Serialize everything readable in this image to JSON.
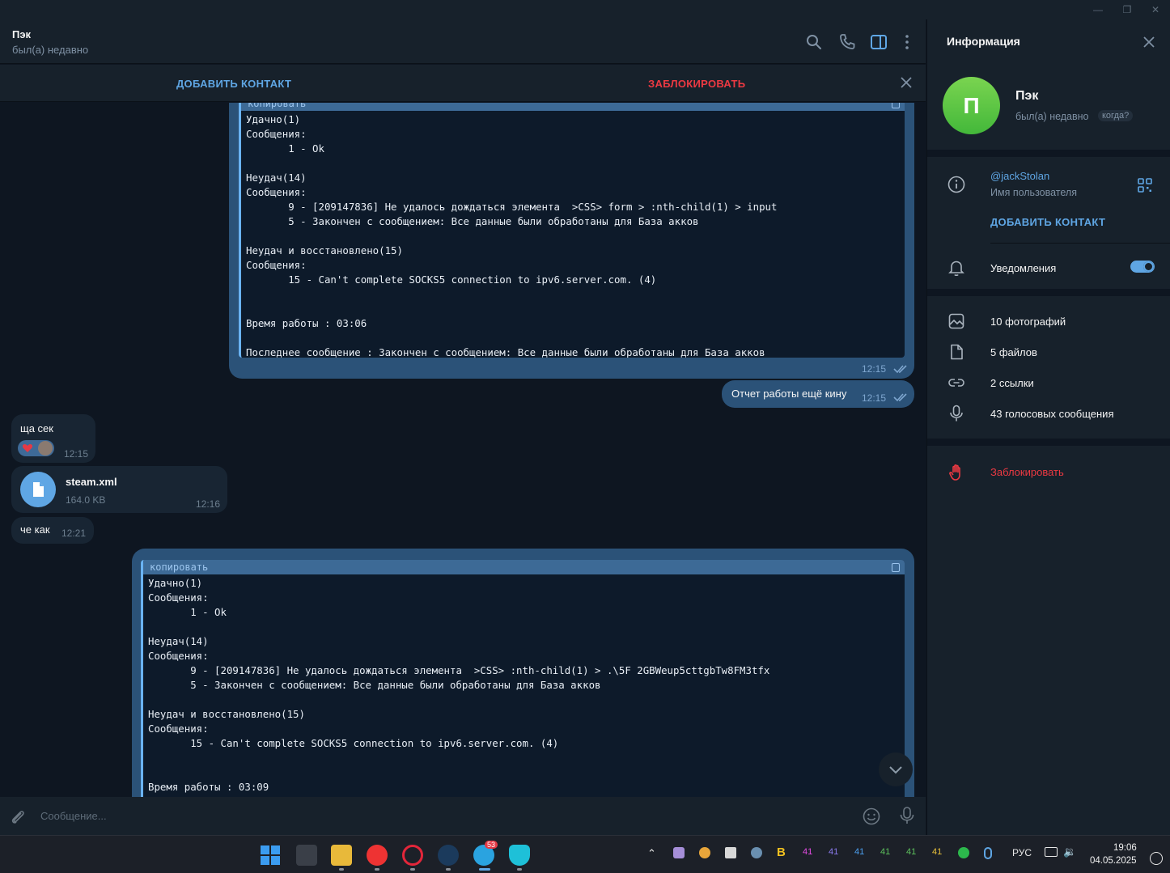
{
  "window": {
    "minimize": "—",
    "restore": "❐",
    "close": "✕"
  },
  "chat": {
    "name": "Пэк",
    "status": "был(а) недавно"
  },
  "action_bar": {
    "add_contact": "ДОБАВИТЬ КОНТАКТ",
    "block": "ЗАБЛОКИРОВАТЬ"
  },
  "messages": {
    "code1": {
      "header": "копировать",
      "text": "Удачно(1)\nСообщения:\n       1 - Ok\n\nНеудач(14)\nСообщения:\n       9 - [209147836] Не удалось дождаться элемента  >CSS> form > :nth-child(1) > input\n       5 - Закончен с сообщением: Все данные были обработаны для База акков\n\nНеудач и восстановлено(15)\nСообщения:\n       15 - Can't complete SOCKS5 connection to ipv6.server.com. (4)\n\n\nВремя работы : 03:06\n\nПоследнее сообщение : Закончен с сообщением: Все данные были обработаны для База акков",
      "time": "12:15"
    },
    "out2": {
      "text": "Отчет работы ещё кину",
      "time": "12:15"
    },
    "in1": {
      "text": "ща сек",
      "time": "12:15"
    },
    "file": {
      "name": "steam.xml",
      "size": "164.0 KB",
      "time": "12:16"
    },
    "in2": {
      "text": "че как",
      "time": "12:21"
    },
    "code2": {
      "header": "копировать",
      "text": "Удачно(1)\nСообщения:\n       1 - Ok\n\nНеудач(14)\nСообщения:\n       9 - [209147836] Не удалось дождаться элемента  >CSS> :nth-child(1) > .\\5F 2GBWeup5cttgbTw8FM3tfx\n       5 - Закончен с сообщением: Все данные были обработаны для База акков\n\nНеудач и восстановлено(15)\nСообщения:\n       15 - Can't complete SOCKS5 connection to ipv6.server.com. (4)\n\n\nВремя работы : 03:09"
    }
  },
  "composer": {
    "placeholder": "Сообщение..."
  },
  "panel": {
    "title": "Информация",
    "avatar_letter": "П",
    "name": "Пэк",
    "status": "был(а) недавно",
    "when": "когда?",
    "username": "@jackStolan",
    "username_sub": "Имя пользователя",
    "add_contact": "ДОБАВИТЬ КОНТАКТ",
    "notifications": "Уведомления",
    "notifications_on": true,
    "media": [
      {
        "label": "10 фотографий",
        "icon": "photo-icon"
      },
      {
        "label": "5 файлов",
        "icon": "file-icon"
      },
      {
        "label": "2 ссылки",
        "icon": "link-icon"
      },
      {
        "label": "43 голосовых сообщения",
        "icon": "mic-icon"
      }
    ],
    "block": "Заблокировать"
  },
  "taskbar": {
    "badge": "53",
    "lang": "РУС",
    "time": "19:06",
    "date": "04.05.2025",
    "tray_nums": [
      "41",
      "41",
      "41",
      "41",
      "41",
      "41"
    ]
  },
  "colors": {
    "accent": "#5fa6e4",
    "danger": "#ec3942",
    "bubble_out": "#2b5278",
    "bubble_in": "#182533",
    "bg": "#0e1621"
  }
}
